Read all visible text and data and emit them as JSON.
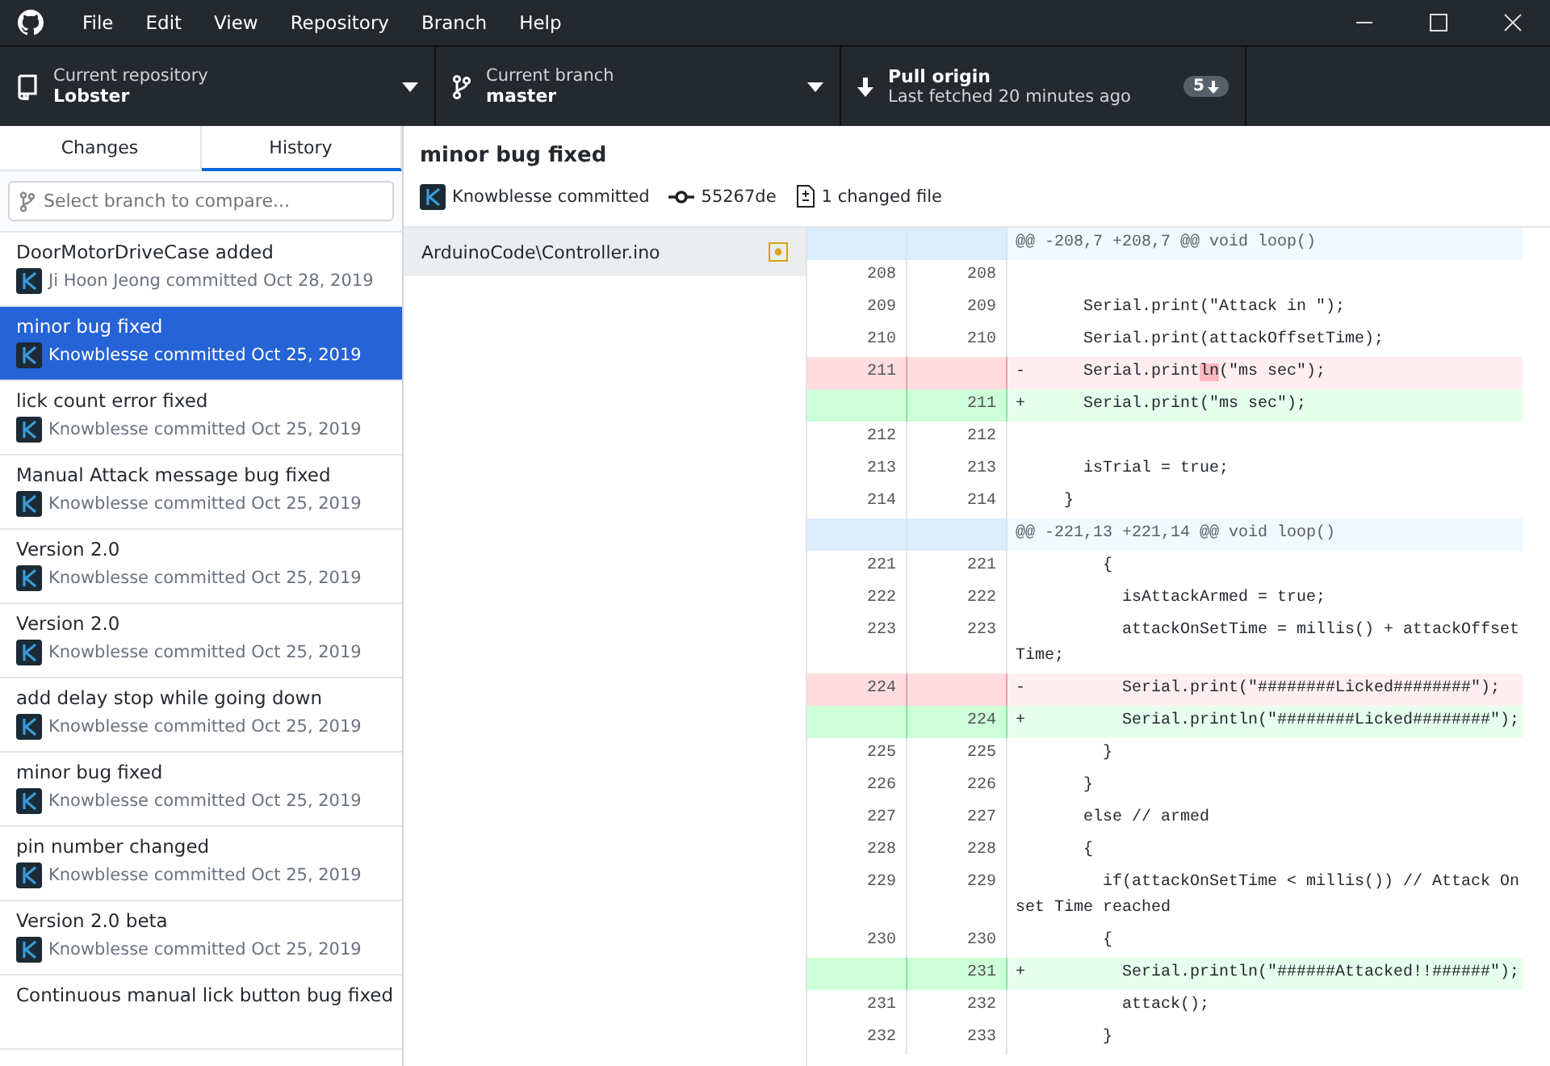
{
  "window": {
    "menu": [
      "File",
      "Edit",
      "View",
      "Repository",
      "Branch",
      "Help"
    ]
  },
  "toolbar": {
    "repository": {
      "label": "Current repository",
      "value": "Lobster"
    },
    "branch": {
      "label": "Current branch",
      "value": "master"
    },
    "pull": {
      "label": "Pull origin",
      "sublabel": "Last fetched 20 minutes ago",
      "badge": "5"
    }
  },
  "sidebar": {
    "tabs": [
      {
        "label": "Changes",
        "selected": false
      },
      {
        "label": "History",
        "selected": true
      }
    ],
    "branch_filter": {
      "placeholder": "Select branch to compare..."
    },
    "commits": [
      {
        "summary": "DoorMotorDriveCase added",
        "meta": "Ji Hoon Jeong committed Oct 28, 2019",
        "selected": false
      },
      {
        "summary": "minor bug fixed",
        "meta": "Knowblesse committed Oct 25, 2019",
        "selected": true
      },
      {
        "summary": "lick count error fixed",
        "meta": "Knowblesse committed Oct 25, 2019",
        "selected": false
      },
      {
        "summary": "Manual Attack message bug fixed",
        "meta": "Knowblesse committed Oct 25, 2019",
        "selected": false
      },
      {
        "summary": "Version 2.0",
        "meta": "Knowblesse committed Oct 25, 2019",
        "selected": false
      },
      {
        "summary": "Version 2.0",
        "meta": "Knowblesse committed Oct 25, 2019",
        "selected": false
      },
      {
        "summary": "add delay stop while going down",
        "meta": "Knowblesse committed Oct 25, 2019",
        "selected": false
      },
      {
        "summary": "minor bug fixed",
        "meta": "Knowblesse committed Oct 25, 2019",
        "selected": false
      },
      {
        "summary": "pin number changed",
        "meta": "Knowblesse committed Oct 25, 2019",
        "selected": false
      },
      {
        "summary": "Version 2.0 beta",
        "meta": "Knowblesse committed Oct 25, 2019",
        "selected": false
      },
      {
        "summary": "Continuous manual lick button bug fixed",
        "selected": false
      }
    ]
  },
  "commit": {
    "title": "minor bug fixed",
    "author": "Knowblesse committed",
    "sha": "55267de",
    "changed_files": "1 changed file"
  },
  "files": [
    {
      "path": "ArduinoCode\\Controller.ino",
      "selected": true
    }
  ],
  "diff": [
    {
      "kind": "hunk",
      "text": "@@ -208,7 +208,7 @@ void loop()"
    },
    {
      "kind": "context",
      "old": "208",
      "new": "208"
    },
    {
      "kind": "context",
      "old": "209",
      "new": "209",
      "text": "       Serial.print(\"Attack in \");"
    },
    {
      "kind": "context",
      "old": "210",
      "new": "210",
      "text": "       Serial.print(attackOffsetTime);"
    },
    {
      "kind": "del",
      "old": "211",
      "segments": [
        {
          "text": "-      Serial.print",
          "changed": false
        },
        {
          "text": "ln",
          "changed": true
        },
        {
          "text": "(\"ms sec\");",
          "changed": false
        }
      ]
    },
    {
      "kind": "add",
      "new": "211",
      "text": "+      Serial.print(\"ms sec\");"
    },
    {
      "kind": "context",
      "old": "212",
      "new": "212"
    },
    {
      "kind": "context",
      "old": "213",
      "new": "213",
      "text": "       isTrial = true;"
    },
    {
      "kind": "context",
      "old": "214",
      "new": "214",
      "text": "     }"
    },
    {
      "kind": "hunk",
      "text": "@@ -221,13 +221,14 @@ void loop()"
    },
    {
      "kind": "context",
      "old": "221",
      "new": "221",
      "text": "         {"
    },
    {
      "kind": "context",
      "old": "222",
      "new": "222",
      "text": "           isAttackArmed = true;"
    },
    {
      "kind": "context",
      "old": "223",
      "new": "223",
      "text": "           attackOnSetTime = millis() + attackOffsetTime;"
    },
    {
      "kind": "del",
      "old": "224",
      "text": "-          Serial.print(\"########Licked########\");"
    },
    {
      "kind": "add",
      "new": "224",
      "text": "+          Serial.println(\"########Licked########\");"
    },
    {
      "kind": "context",
      "old": "225",
      "new": "225",
      "text": "         }"
    },
    {
      "kind": "context",
      "old": "226",
      "new": "226",
      "text": "       }"
    },
    {
      "kind": "context",
      "old": "227",
      "new": "227",
      "text": "       else // armed"
    },
    {
      "kind": "context",
      "old": "228",
      "new": "228",
      "text": "       {"
    },
    {
      "kind": "context",
      "old": "229",
      "new": "229",
      "text": "         if(attackOnSetTime < millis()) // Attack Onset Time reached"
    },
    {
      "kind": "context",
      "old": "230",
      "new": "230",
      "text": "         {"
    },
    {
      "kind": "add",
      "new": "231",
      "text": "+          Serial.println(\"######Attacked!!######\");"
    },
    {
      "kind": "context",
      "old": "231",
      "new": "232",
      "text": "           attack();"
    },
    {
      "kind": "context",
      "old": "232",
      "new": "233",
      "text": "         }"
    }
  ]
}
